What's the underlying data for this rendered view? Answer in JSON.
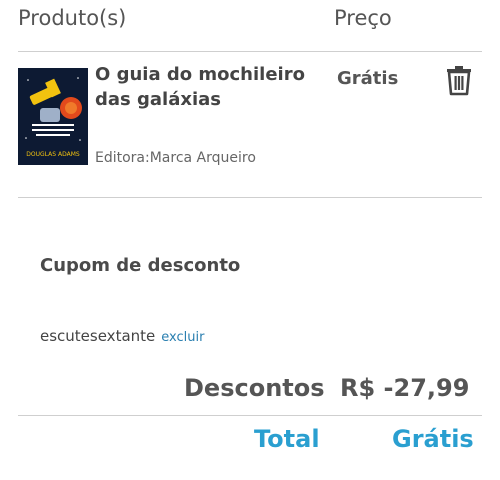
{
  "cart": {
    "product_header": "Produto(s)",
    "price_header": "Preço",
    "items": [
      {
        "title": "O guia do mochileiro das galáxias",
        "publisher": "Editora:Marca Arqueiro",
        "price": "Grátis",
        "cover_author": "DOUGLAS ADAMS",
        "remove_icon": "trash-icon"
      }
    ]
  },
  "coupon": {
    "title": "Cupom de desconto",
    "code": "escutesextante",
    "remove_label": "excluir"
  },
  "summary": {
    "discount_label": "Descontos",
    "discount_value": "R$ -27,99",
    "total_label": "Total",
    "total_value": "Grátis"
  },
  "colors": {
    "accent": "#2a9fd0",
    "link": "#2a7fb0",
    "text": "#444444",
    "divider": "#cfcfcf"
  }
}
